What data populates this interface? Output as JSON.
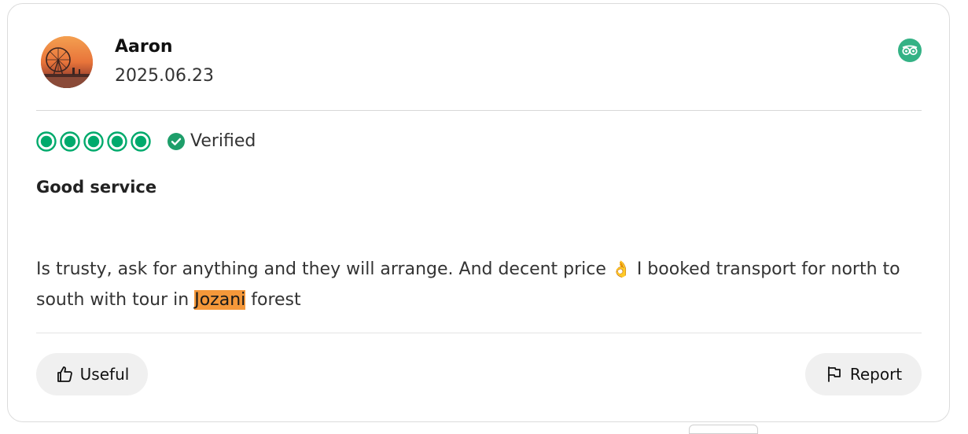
{
  "review": {
    "author": "Aaron",
    "date": "2025.06.23",
    "rating": 5,
    "rating_max": 5,
    "verified_label": "Verified",
    "title": "Good service",
    "body_part1": "Is trusty, ask for anything and they will arrange. And decent price ",
    "emoji": "👌",
    "body_part2": " I booked transport for north to south with tour in ",
    "highlighted_word": "Jozani",
    "body_part3": " forest"
  },
  "actions": {
    "useful_label": "Useful",
    "report_label": "Report"
  },
  "icons": {
    "brand": "tripadvisor-owl-icon",
    "useful": "thumbs-up-icon",
    "report": "flag-icon",
    "verified": "check-circle-icon"
  },
  "colors": {
    "accent": "#34b285",
    "rating_green": "#00aa6c",
    "highlight": "#f5983a",
    "button_bg": "#f0f0f0"
  }
}
